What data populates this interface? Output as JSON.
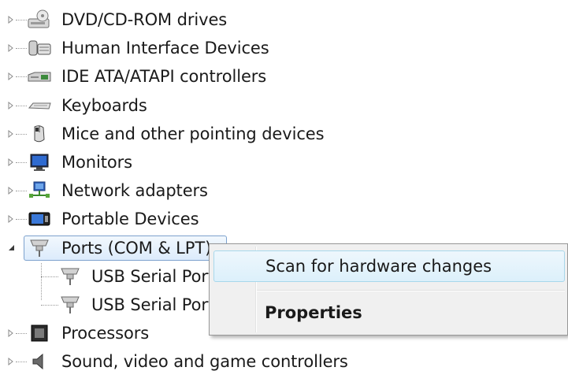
{
  "tree": {
    "items": [
      {
        "label": "DVD/CD-ROM drives",
        "icon": "dvd-drive-icon",
        "expanded": false
      },
      {
        "label": "Human Interface Devices",
        "icon": "hid-icon",
        "expanded": false
      },
      {
        "label": "IDE ATA/ATAPI controllers",
        "icon": "ide-controller-icon",
        "expanded": false
      },
      {
        "label": "Keyboards",
        "icon": "keyboard-icon",
        "expanded": false
      },
      {
        "label": "Mice and other pointing devices",
        "icon": "mouse-icon",
        "expanded": false
      },
      {
        "label": "Monitors",
        "icon": "monitor-icon",
        "expanded": false
      },
      {
        "label": "Network adapters",
        "icon": "network-adapter-icon",
        "expanded": false
      },
      {
        "label": "Portable Devices",
        "icon": "portable-device-icon",
        "expanded": false
      },
      {
        "label": "Ports (COM & LPT)",
        "icon": "port-icon",
        "expanded": true,
        "selected": true
      },
      {
        "label": "USB Serial Port",
        "icon": "port-icon",
        "child": true
      },
      {
        "label": "USB Serial Port",
        "icon": "port-icon",
        "child": true
      },
      {
        "label": "Processors",
        "icon": "processor-icon",
        "expanded": false
      },
      {
        "label": "Sound, video and game controllers",
        "icon": "sound-icon",
        "expanded": false
      }
    ]
  },
  "context_menu": {
    "scan_label": "Scan for hardware changes",
    "properties_label": "Properties"
  },
  "colors": {
    "selection_border": "#7da2ce",
    "menu_background": "#f0f0f0",
    "menu_hover_border": "#a8d8eb"
  }
}
